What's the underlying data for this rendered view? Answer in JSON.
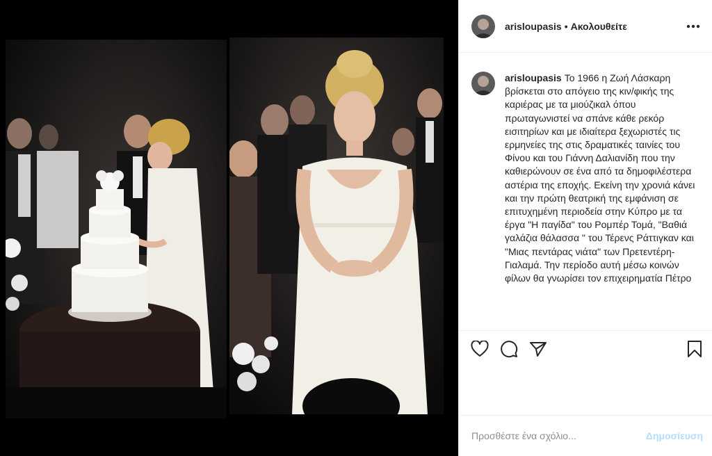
{
  "post": {
    "username": "arisloupasis",
    "separator": "•",
    "follow_state": "Ακολουθείτε",
    "more_icon": "more-horizontal-icon"
  },
  "caption": {
    "username": "arisloupasis",
    "text": "Το 1966 η Ζωή Λάσκαρη βρίσκεται στο απόγειο της κιν/φικής της καριέρας με τα μιούζικαλ όπου πρωταγωνιστεί να σπάνε κάθε ρεκόρ εισιτηρίων και με ιδιαίτερα ξεχωριστές τις ερμηνείες της στις δραματικές ταινίες του Φίνου και του Γιάννη Δαλιανίδη που την καθιερώνουν σε ένα από τα δημοφιλέστερα αστέρια της εποχής. Εκείνη την χρονιά κάνει και την πρώτη θεατρική της εμφάνιση σε επιτυχημένη περιοδεία στην Κύπρο με τα έργα \"Η παγίδα\" του Ρομπέρ Τομά, \"Βαθιά γαλάζια θάλασσα \" του Τέρενς Ράττιγκαν και \"Μιας πεντάρας νιάτα\" των Πρετεντέρη-Γιαλαμά. Την περίοδο αυτή μέσω κοινών φίλων θα γνωρίσει τον επιχειρηματία Πέτρο"
  },
  "actions": {
    "like_icon": "heart-icon",
    "comment_icon": "comment-icon",
    "share_icon": "share-icon",
    "save_icon": "bookmark-icon"
  },
  "comment_box": {
    "placeholder": "Προσθέστε ένα σχόλιο...",
    "post_label": "Δημοσίευση"
  },
  "colors": {
    "post_button_disabled": "#b2dffc",
    "divider": "#efefef",
    "text": "#262626",
    "muted": "#8e8e8e"
  }
}
